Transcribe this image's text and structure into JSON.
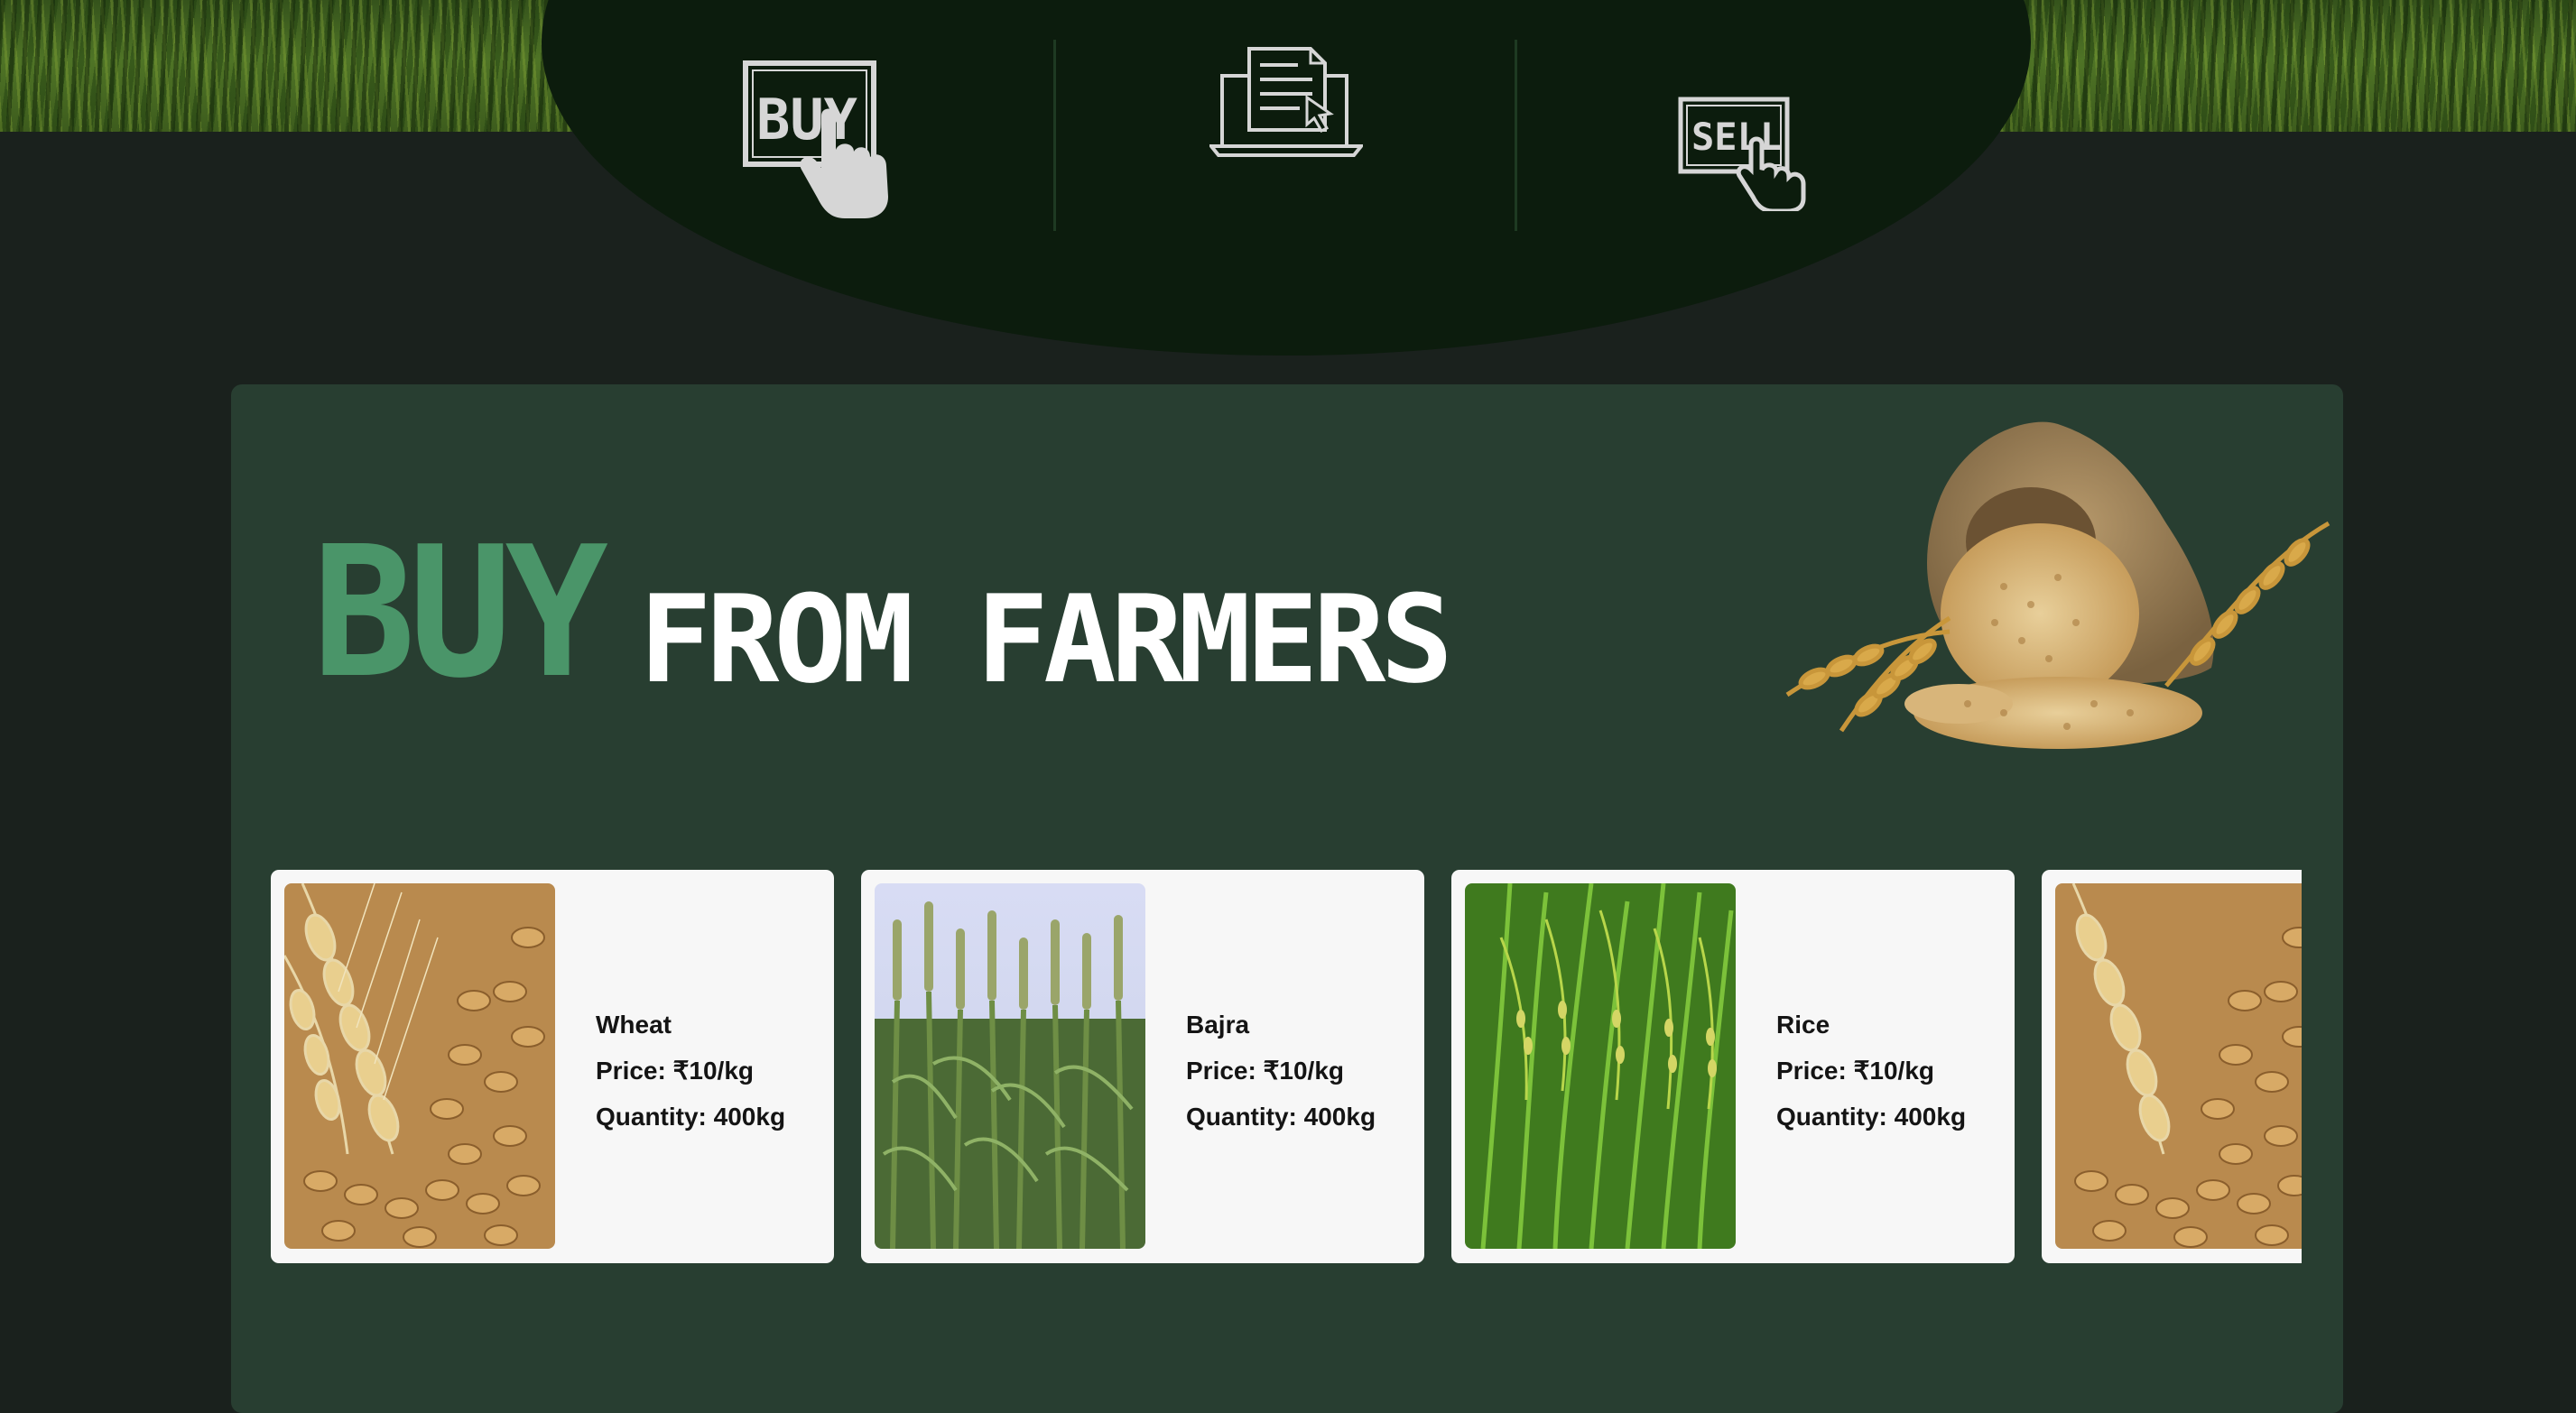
{
  "nav": {
    "buy_icon_text": "BUY",
    "sell_icon_text": "SELL"
  },
  "hero": {
    "title_accent": "BUY",
    "title_rest": "FROM FARMERS"
  },
  "products": [
    {
      "name": "Wheat",
      "price": "Price: ₹10/kg",
      "quantity": "Quantity: 400kg",
      "image": "wheat-grain"
    },
    {
      "name": "Bajra",
      "price": "Price: ₹10/kg",
      "quantity": "Quantity: 400kg",
      "image": "bajra-field"
    },
    {
      "name": "Rice",
      "price": "Price: ₹10/kg",
      "quantity": "Quantity: 400kg",
      "image": "rice-plants"
    },
    {
      "name": "",
      "price": "",
      "quantity": "",
      "image": "wheat-grain"
    }
  ],
  "colors": {
    "page_bg": "#1a211d",
    "nav_oval": "#0c1c0d",
    "panel_bg": "#283e31",
    "accent_green": "#4a9569",
    "card_bg": "#f7f7f7"
  }
}
